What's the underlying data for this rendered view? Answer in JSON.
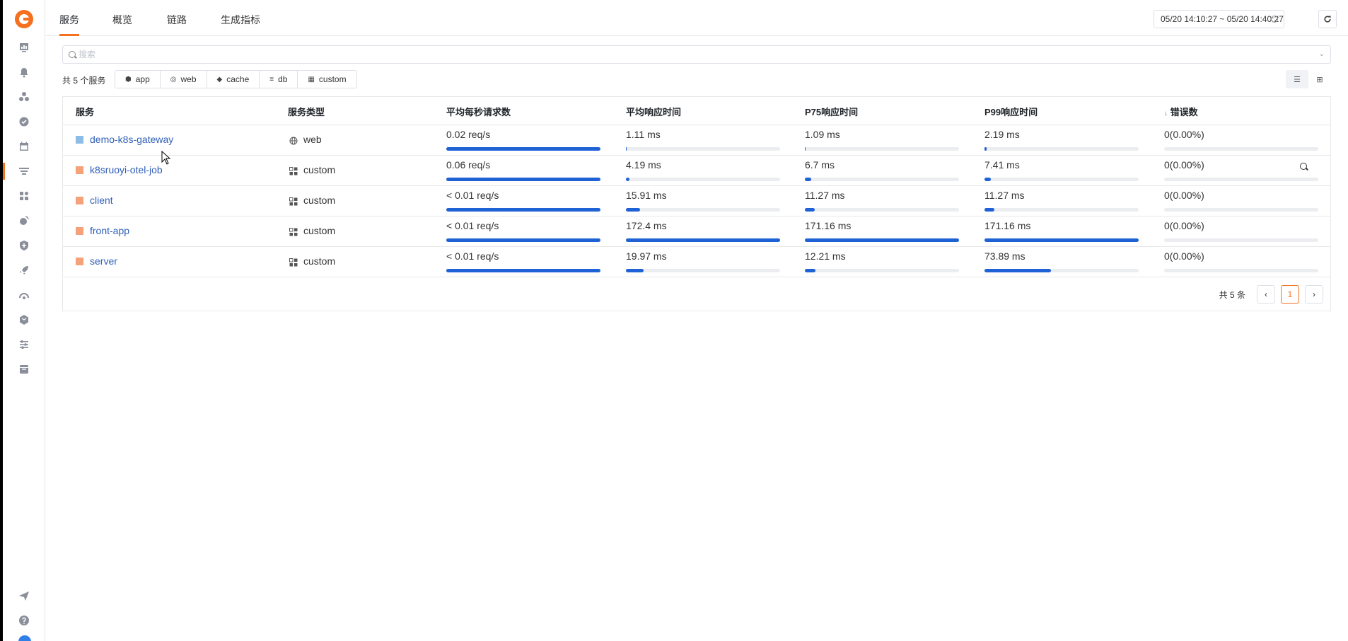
{
  "tabs": [
    {
      "label": "服务",
      "active": true
    },
    {
      "label": "概览"
    },
    {
      "label": "链路"
    },
    {
      "label": "生成指标"
    }
  ],
  "time_range": "05/20 14:10:27 ~ 05/20 14:40:27",
  "search": {
    "placeholder": "搜索"
  },
  "total_services": "共 5 个服务",
  "filters": [
    {
      "label": "app",
      "icon": "cube-icon"
    },
    {
      "label": "web",
      "icon": "globe-icon"
    },
    {
      "label": "cache",
      "icon": "layers-icon"
    },
    {
      "label": "db",
      "icon": "database-icon"
    },
    {
      "label": "custom",
      "icon": "grid-icon"
    }
  ],
  "columns": [
    "服务",
    "服务类型",
    "平均每秒请求数",
    "平均响应时间",
    "P75响应时间",
    "P99响应时间",
    "错误数"
  ],
  "sort_indicator": "↓",
  "rows": [
    {
      "name": "demo-k8s-gateway",
      "color": "#8bbde6",
      "type": "web",
      "rps": "0.02 req/s",
      "rps_pct": 100,
      "avg": "1.11 ms",
      "avg_pct": 0.6,
      "p75": "1.09 ms",
      "p75_pct": 0.6,
      "p99": "2.19 ms",
      "p99_pct": 1.2,
      "errors": "0(0.00%)"
    },
    {
      "name": "k8sruoyi-otel-job",
      "color": "#f5a27a",
      "type": "custom",
      "rps": "0.06 req/s",
      "rps_pct": 100,
      "avg": "4.19 ms",
      "avg_pct": 2.4,
      "p75": "6.7 ms",
      "p75_pct": 3.9,
      "p99": "7.41 ms",
      "p99_pct": 4.3,
      "errors": "0(0.00%)"
    },
    {
      "name": "client",
      "color": "#f5a27a",
      "type": "custom",
      "rps": "< 0.01 req/s",
      "rps_pct": 100,
      "avg": "15.91 ms",
      "avg_pct": 9.2,
      "p75": "11.27 ms",
      "p75_pct": 6.6,
      "p99": "11.27 ms",
      "p99_pct": 6.6,
      "errors": "0(0.00%)"
    },
    {
      "name": "front-app",
      "color": "#f5a27a",
      "type": "custom",
      "rps": "< 0.01 req/s",
      "rps_pct": 100,
      "avg": "172.4 ms",
      "avg_pct": 100,
      "p75": "171.16 ms",
      "p75_pct": 100,
      "p99": "171.16 ms",
      "p99_pct": 100,
      "errors": "0(0.00%)"
    },
    {
      "name": "server",
      "color": "#f5a27a",
      "type": "custom",
      "rps": "< 0.01 req/s",
      "rps_pct": 100,
      "avg": "19.97 ms",
      "avg_pct": 11.6,
      "p75": "12.21 ms",
      "p75_pct": 7.1,
      "p99": "73.89 ms",
      "p99_pct": 43.2,
      "errors": "0(0.00%)"
    }
  ],
  "pagination": {
    "total": "共 5 条",
    "current": "1",
    "prev": "‹",
    "next": "›"
  },
  "colors": {
    "accent": "#f5701f",
    "bar": "#1f62d6",
    "link": "#2f5fb8"
  }
}
